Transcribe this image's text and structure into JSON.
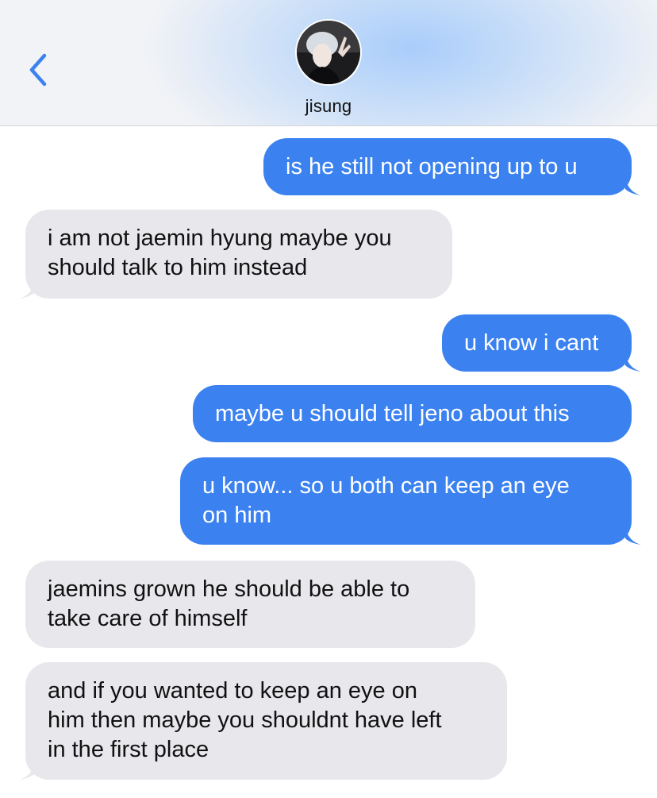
{
  "header": {
    "contact_name": "jisung",
    "back_icon": "chevron-left-icon",
    "accent_color": "#3b82f0"
  },
  "messages": [
    {
      "direction": "sent",
      "text": "is he still not opening up to u"
    },
    {
      "direction": "received",
      "text": "i am not jaemin hyung maybe you\nshould talk to him instead"
    },
    {
      "direction": "sent",
      "text": "u know i cant"
    },
    {
      "direction": "sent",
      "text": "maybe u should tell jeno about this"
    },
    {
      "direction": "sent",
      "text": "u know... so u both can keep an eye\non him"
    },
    {
      "direction": "received",
      "text": "jaemins grown he should be able to\ntake care of himself"
    },
    {
      "direction": "received",
      "text": "and if you wanted to keep an eye on\nhim then maybe you shouldnt have left\nin the first place"
    }
  ],
  "colors": {
    "sent_bubble": "#3b82f0",
    "received_bubble": "#e7e7ec"
  }
}
